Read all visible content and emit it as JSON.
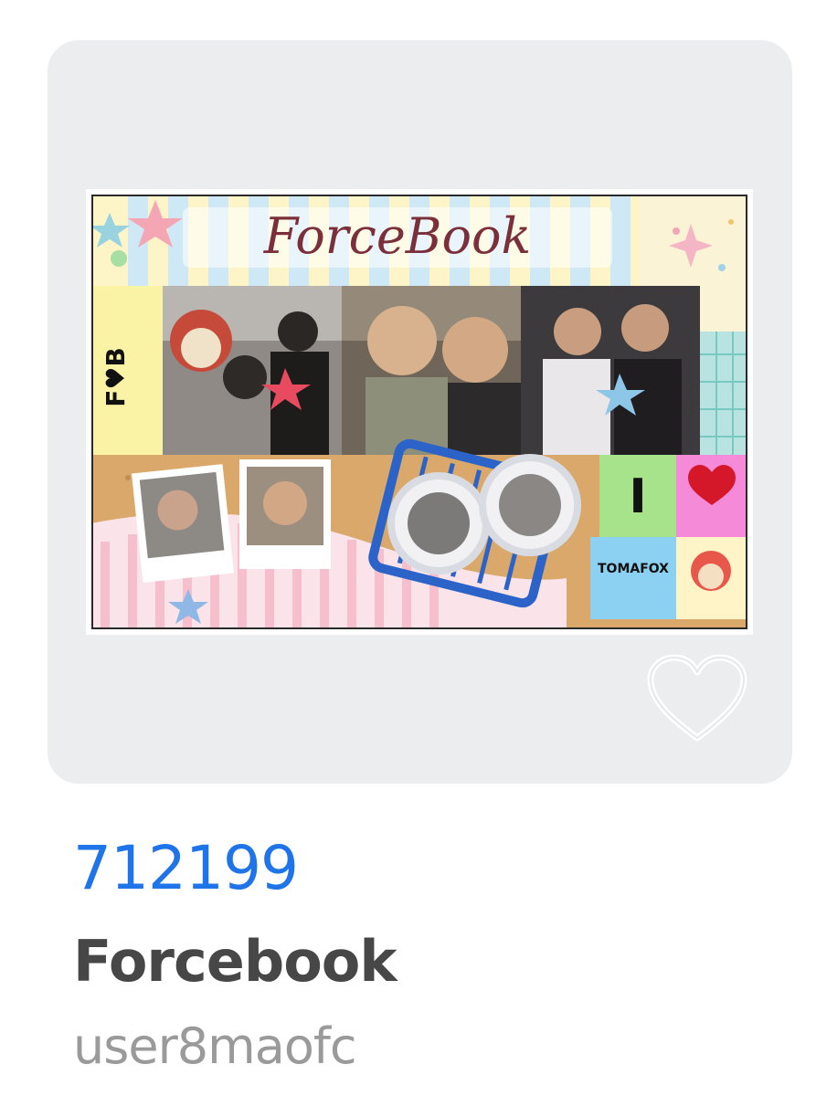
{
  "item": {
    "code": "712199",
    "title": "Forcebook",
    "username": "user8maofc"
  },
  "thumbnail": {
    "banner_text": "ForceBook",
    "side_label": "F♥B",
    "tag_text": "TOMAFOX",
    "puzzle_letter": "I"
  },
  "icons": {
    "favorite": "heart-outline-icon"
  },
  "colors": {
    "card_bg": "#ecedef",
    "code": "#1e74e8",
    "title": "#474747",
    "username": "#9a9a9a"
  }
}
